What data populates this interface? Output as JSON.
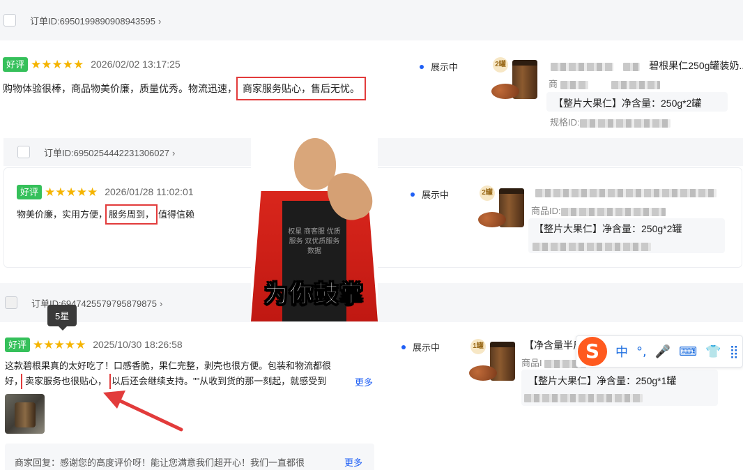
{
  "orders": [
    {
      "order_id": "订单ID:6950199890908943595",
      "badge": "好评",
      "stars": "★★★★★",
      "date": "2026/02/02 13:17:25",
      "review_pre": "购物体验很棒，商品物美价廉，质量优秀。物流迅速，",
      "review_highlight": "商家服务贴心，售后无忧。",
      "status": "展示中",
      "product_title": "碧根果仁250g罐装奶...",
      "product_id_label": "商",
      "spec": "【整片大果仁】净含量：250g*2罐",
      "spec_id_label": "规格ID:",
      "img_badge": "2罐"
    },
    {
      "order_id": "订单ID:6950254442231306027",
      "badge": "好评",
      "stars": "★★★★★",
      "date": "2026/01/28 11:02:01",
      "review_pre": "物美价廉，实用方便，",
      "review_highlight": "服务周到，",
      "review_post": "值得信赖",
      "status": "展示中",
      "product_id_label": "商品ID:",
      "spec": "【整片大果仁】净含量：250g*2罐",
      "img_badge": "2罐"
    },
    {
      "order_id": "订单ID:6947425579795879875",
      "badge": "好评",
      "stars": "★★★★★",
      "date": "2025/10/30 18:26:58",
      "review_line1": "这款碧根果真的太好吃了！口感香脆，果仁完整，剥壳也很方便。包装和物流都很",
      "review_line2_pre": "好，",
      "review_highlight": "卖家服务也很贴心，",
      "review_line2_post": "以后还会继续支持。\"\"从收到货的那一刻起，就感受到",
      "more": "更多",
      "status": "展示中",
      "product_title": "【净含量半斤",
      "product_id_label": "商品I",
      "spec": "【整片大果仁】净含量：250g*1罐",
      "img_badge": "1罐",
      "tooltip": "5星",
      "reply": "商家回复：感谢您的高度评价呀！能让您满意我们超开心！我们一直都很",
      "reply_more": "更多"
    }
  ],
  "overlay": {
    "caption": "为你鼓掌",
    "shirt_text": "权星 商客服 优质服务 双优质服务数据"
  },
  "ime_toolbar": {
    "logo": "S",
    "items": [
      "中",
      "°,",
      "🎤",
      "⌨",
      "👕",
      "⣿"
    ]
  },
  "colors": {
    "highlight": "#e23b3b",
    "good_badge": "#35c05a",
    "star": "#f5b400",
    "link": "#1f5ff5"
  }
}
